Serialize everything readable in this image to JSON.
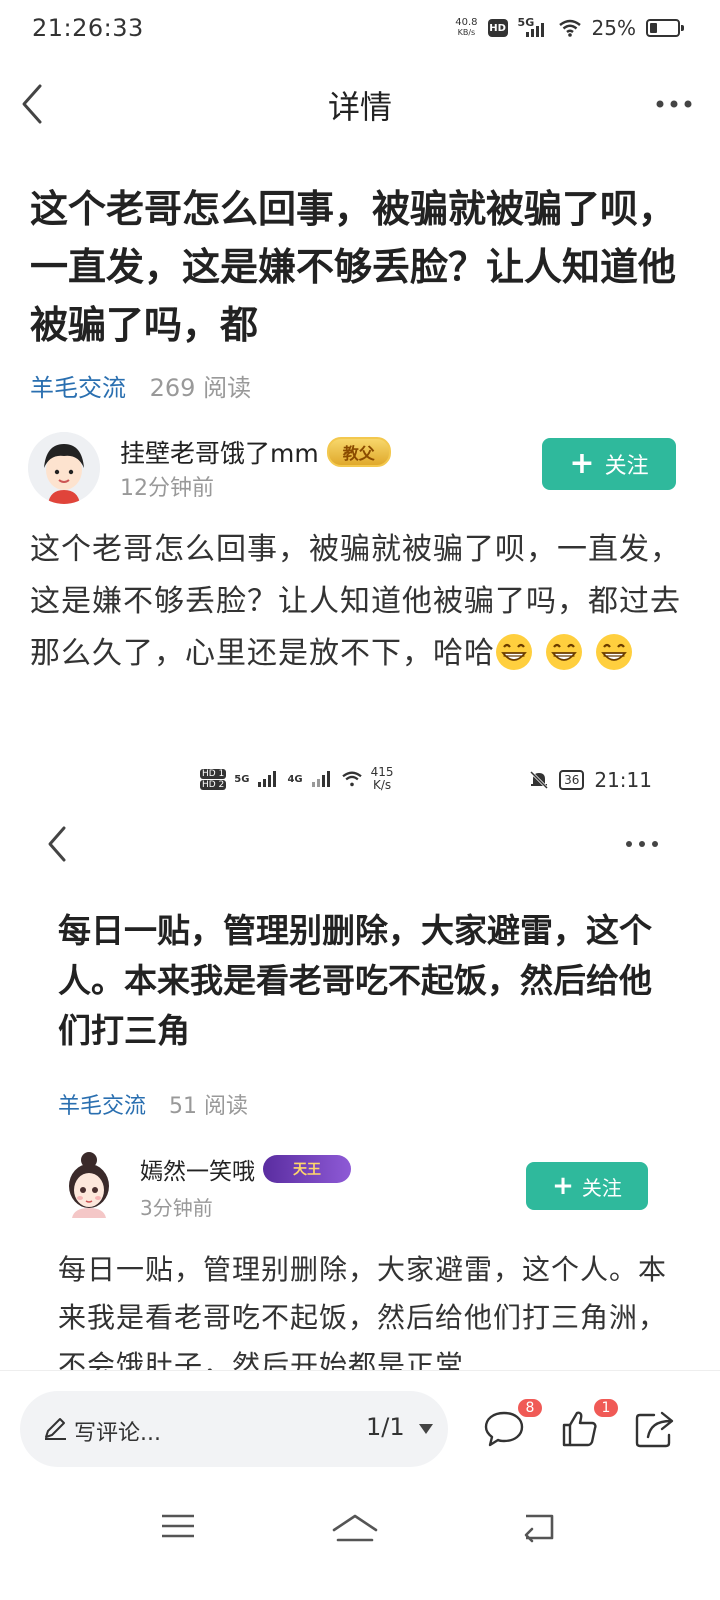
{
  "status_bar": {
    "time": "21:26:33",
    "net_speed_value": "40.8",
    "net_speed_unit": "KB/s",
    "hd": "HD",
    "signal": "5G",
    "battery": "25%",
    "battery_level": 0.25
  },
  "nav": {
    "title": "详情"
  },
  "post": {
    "title": "这个老哥怎么回事，被骗就被骗了呗，一直发，这是嫌不够丢脸？让人知道他被骗了吗，都",
    "category": "羊毛交流",
    "views": "269 阅读",
    "author": "挂壁老哥饿了mm",
    "author_badge": "教父",
    "time": "12分钟前",
    "follow_label": "关注",
    "body": "这个老哥怎么回事，被骗就被骗了呗，一直发，这是嫌不够丢脸？让人知道他被骗了吗，都过去那么久了，心里还是放不下，哈哈"
  },
  "embed": {
    "status": {
      "hd1": "HD 1",
      "hd2": "HD 2",
      "sig1": "5G",
      "sig2": "4G",
      "speed_value": "415",
      "speed_unit": "K/s",
      "battery": "36",
      "time": "21:11"
    },
    "title": "每日一贴，管理别删除，大家避雷，这个人。本来我是看老哥吃不起饭，然后给他们打三角",
    "category": "羊毛交流",
    "views": "51 阅读",
    "author": "嫣然一笑哦",
    "author_badge": "天王",
    "time": "3分钟前",
    "follow_label": "关注",
    "body": "每日一贴，管理别删除，大家避雷，这个人。本来我是看老哥吃不起饭，然后给他们打三角洲，不会饿肚子，然后开始都是正常"
  },
  "bottom_bar": {
    "comment_placeholder": "写评论...",
    "page_indicator": "1/1",
    "comment_count": "8",
    "like_count": "1"
  }
}
